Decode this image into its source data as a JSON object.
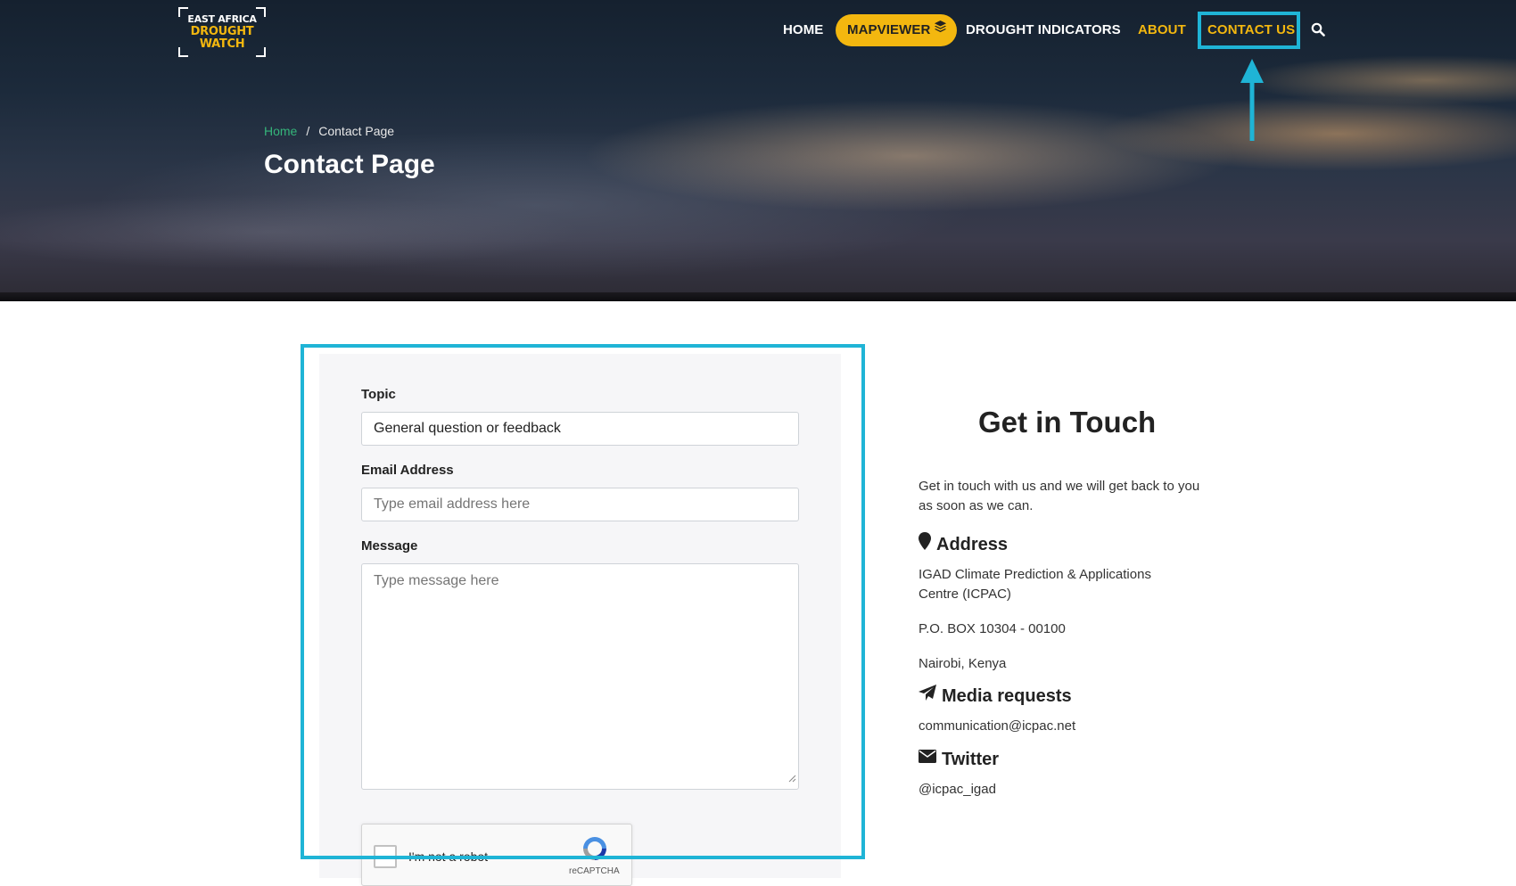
{
  "logo": {
    "line1": "EAST AFRICA",
    "line2": "DROUGHT",
    "line3": "WATCH"
  },
  "nav": {
    "home": "HOME",
    "mapviewer": "MAPVIEWER",
    "drought_indicators": "DROUGHT INDICATORS",
    "about": "ABOUT",
    "contact_us": "CONTACT US",
    "search_icon": "search-icon"
  },
  "breadcrumb": {
    "home": "Home",
    "separator": "/",
    "current": "Contact Page"
  },
  "page_title": "Contact Page",
  "form": {
    "topic_label": "Topic",
    "topic_value": "General question or feedback",
    "email_label": "Email Address",
    "email_placeholder": "Type email address here",
    "message_label": "Message",
    "message_placeholder": "Type message here",
    "captcha_text": "I'm not a robot",
    "captcha_brand": "reCAPTCHA"
  },
  "contact": {
    "title": "Get in Touch",
    "intro": "Get in touch with us and we will get back to you as soon as we can.",
    "address_heading": "Address",
    "address_line1": "IGAD Climate Prediction & Applications Centre (ICPAC)",
    "address_line2": "P.O. BOX 10304 - 00100",
    "address_line3": "Nairobi, Kenya",
    "media_heading": "Media requests",
    "media_email": "communication@icpac.net",
    "twitter_heading": "Twitter",
    "twitter_handle": "@icpac_igad"
  },
  "colors": {
    "brand_yellow": "#f3b70f",
    "highlight": "#1fb4d6",
    "link_green": "#35b57a"
  }
}
